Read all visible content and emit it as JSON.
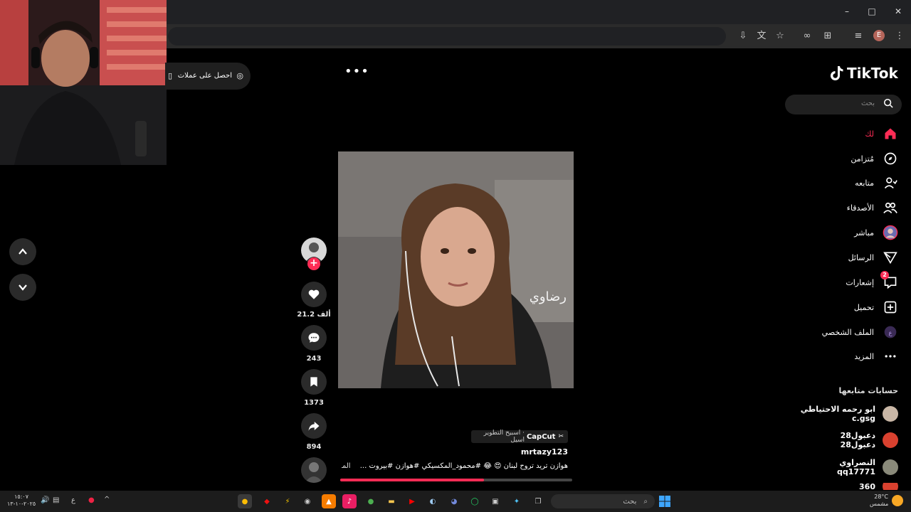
{
  "browser": {
    "window_controls": [
      "–",
      "□",
      "✕"
    ],
    "profile_initial": "E",
    "toolbar_icons": [
      "install-icon",
      "translate-icon",
      "star-icon",
      "extension-icon",
      "puzzle-icon",
      "media-icon",
      "profile-icon",
      "menu-icon"
    ]
  },
  "header": {
    "get_coins": "احصل على عملات",
    "more": "•••"
  },
  "sidebar": {
    "logo": "TikTok",
    "search_placeholder": "بحث",
    "nav": [
      {
        "label": "لك",
        "icon": "home-icon",
        "active": true
      },
      {
        "label": "مُتزامن",
        "icon": "compass-icon"
      },
      {
        "label": "متابعه",
        "icon": "user-follow-icon"
      },
      {
        "label": "الأصدقاء",
        "icon": "friends-icon"
      },
      {
        "label": "مباشر",
        "icon": "live-icon"
      },
      {
        "label": "الرسائل",
        "icon": "send-icon"
      },
      {
        "label": "إشعارات",
        "icon": "inbox-icon",
        "badge": "2"
      },
      {
        "label": "تحميل",
        "icon": "upload-icon"
      },
      {
        "label": "الملف الشخصي",
        "icon": "profile-icon"
      },
      {
        "label": "المزيد",
        "icon": "more-icon"
      }
    ],
    "following_heading": "حسابات متابعها",
    "following": [
      {
        "name": "ابو رحمه الاحتياطي",
        "handle": "c.gsg"
      },
      {
        "name": "دعبول28",
        "handle": "دعبول28"
      },
      {
        "name": "النصراوي",
        "handle": "qq17771"
      },
      {
        "name": "360",
        "handle": ""
      }
    ]
  },
  "video": {
    "watermark": "رضاوي",
    "capcut_label": "CapCut",
    "capcut_text": "· اسبيح التطوير اسيل",
    "author": "mrtazy123",
    "caption": "هوازن تريد تروح لبنان 😍 😂 #محمود_المكسيكي #هوازن #بيروت ...",
    "more": "المزيد",
    "progress": 0.62
  },
  "actions": {
    "likes": "21.2 ألف",
    "comments": "243",
    "saves": "1373",
    "shares": "894"
  },
  "taskbar": {
    "search_label": "بحث",
    "weather_temp": "28°C",
    "weather_desc": "مشمس",
    "clock_time": "١٥:٠٧",
    "clock_date": "٢٠٢٥-١٠-١٣",
    "lang": "ع"
  },
  "colors": {
    "accent": "#fe2c55",
    "sidebar_bg": "#000000",
    "chrome": "#202124"
  }
}
